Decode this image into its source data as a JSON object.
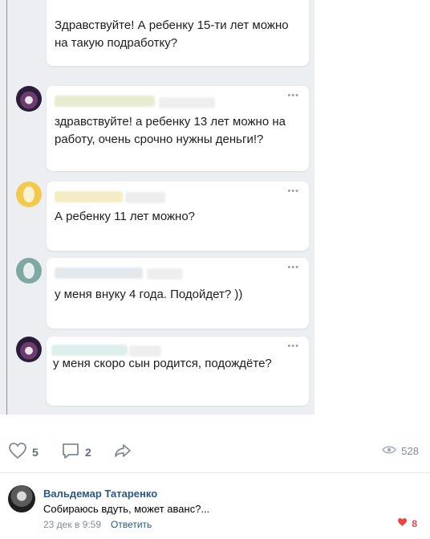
{
  "post_image": {
    "messages": [
      {
        "text_line1": "Здравствуйте! А ребенку 15-ти лет можно",
        "text_line2": "на такую подработку?"
      },
      {
        "text_line1": "здравствуйте! а ребенку 13 лет можно на",
        "text_line2": "работу, очень срочно нужны деньги!?"
      },
      {
        "text_line1": "А ребенку 11 лет можно?"
      },
      {
        "text_line1": "у меня внуку 4 года. Подойдет? ))"
      },
      {
        "text_line1": "у меня скоро сын родится, подождёте?"
      }
    ],
    "dots": "•••"
  },
  "actions": {
    "likes": "5",
    "comments": "2",
    "views": "528"
  },
  "comment": {
    "author": "Вальдемар Татаренко",
    "text": "Собираюсь вдуть, может аванс?...",
    "date": "23 дек в 9:59",
    "reply": "Ответить",
    "likes": "8"
  },
  "colors": {
    "link": "#2a5885",
    "like_active": "#e64646",
    "muted": "#818c99"
  }
}
